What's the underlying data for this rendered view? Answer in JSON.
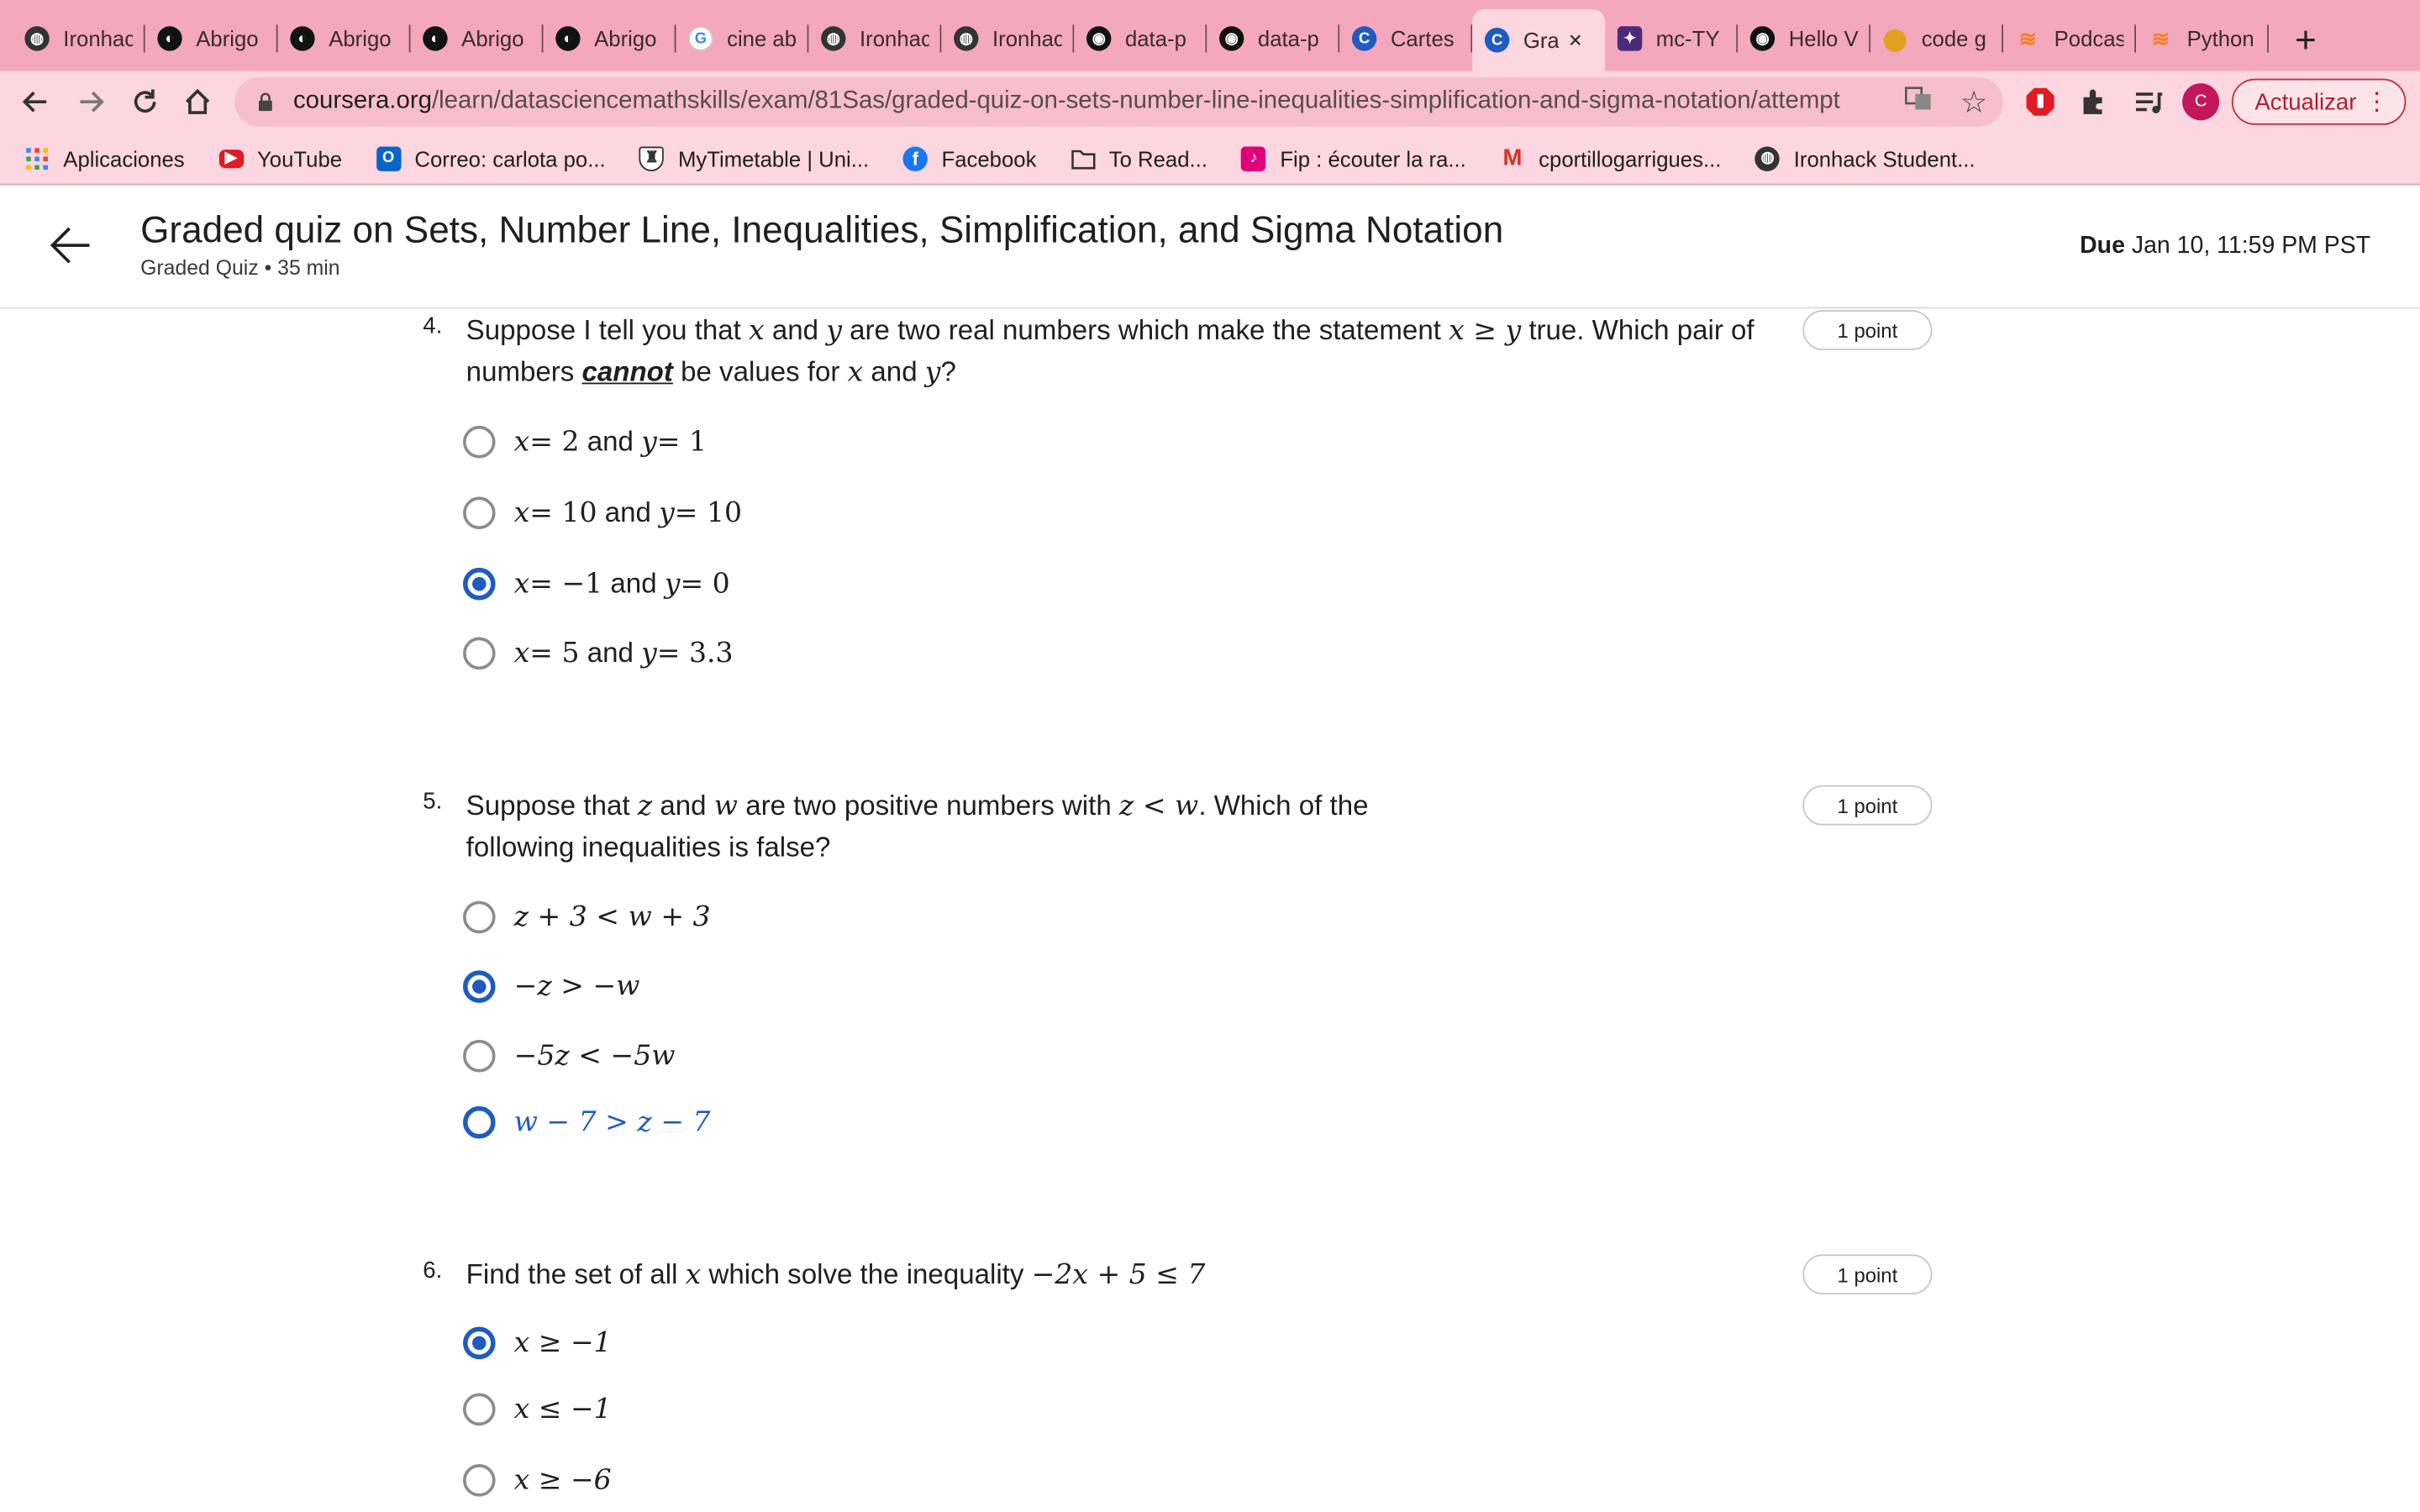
{
  "browser": {
    "tabs": [
      {
        "label": "Ironhac",
        "icon": "globe-icon",
        "color": "#333333"
      },
      {
        "label": "Abrigo",
        "icon": "brand-icon",
        "color": "#111111"
      },
      {
        "label": "Abrigo",
        "icon": "brand-icon",
        "color": "#111111"
      },
      {
        "label": "Abrigo",
        "icon": "brand-icon",
        "color": "#111111"
      },
      {
        "label": "Abrigo",
        "icon": "brand-icon",
        "color": "#111111"
      },
      {
        "label": "cine ab",
        "icon": "google-icon",
        "color": "#4285f4"
      },
      {
        "label": "Ironhac",
        "icon": "globe-icon",
        "color": "#333333"
      },
      {
        "label": "Ironhac",
        "icon": "globe-icon",
        "color": "#333333"
      },
      {
        "label": "data-p",
        "icon": "github-icon",
        "color": "#111111"
      },
      {
        "label": "data-p",
        "icon": "github-icon",
        "color": "#111111"
      },
      {
        "label": "Cartes",
        "icon": "coursera-icon",
        "color": "#1f5bc0"
      },
      {
        "label": "Gra",
        "icon": "coursera-icon",
        "color": "#1f5bc0",
        "active": true
      },
      {
        "label": "mc-TY",
        "icon": "shield-icon",
        "color": "#4b2a7a"
      },
      {
        "label": "Hello V",
        "icon": "github-icon",
        "color": "#111111"
      },
      {
        "label": "code g",
        "icon": "map-pin-icon",
        "color": "#e0a020"
      },
      {
        "label": "Podcas",
        "icon": "stack-icon",
        "color": "#f48024"
      },
      {
        "label": "Python",
        "icon": "stack-icon",
        "color": "#f48024"
      }
    ],
    "tab_close": "×",
    "new_tab": "+",
    "url_host": "coursera.org",
    "url_path": "/learn/datasciencemathskills/exam/81Sas/graded-quiz-on-sets-number-line-inequalities-simplification-and-sigma-notation/attempt",
    "update_label": "Actualizar",
    "profile_initial": "C",
    "bookmarks": [
      {
        "label": "Aplicaciones",
        "icon": "apps-grid-icon"
      },
      {
        "label": "YouTube",
        "icon": "youtube-icon"
      },
      {
        "label": "Correo: carlota po...",
        "icon": "outlook-icon"
      },
      {
        "label": "MyTimetable | Uni...",
        "icon": "crest-icon"
      },
      {
        "label": "Facebook",
        "icon": "facebook-icon"
      },
      {
        "label": "To Read...",
        "icon": "folder-icon"
      },
      {
        "label": "Fip : écouter la ra...",
        "icon": "fip-icon"
      },
      {
        "label": "cportillogarrigues...",
        "icon": "gmail-icon"
      },
      {
        "label": "Ironhack Student...",
        "icon": "globe-icon"
      }
    ]
  },
  "header": {
    "title": "Graded quiz on Sets, Number Line, Inequalities, Simplification, and Sigma Notation",
    "subtitle": "Graded Quiz • 35 min",
    "due_label": "Due",
    "due_value": "Jan 10, 11:59 PM PST"
  },
  "questions": [
    {
      "number": "4.",
      "points": "1 point",
      "text": {
        "p1": "Suppose I tell you that ",
        "m1": "x",
        "p2": " and ",
        "m2": "y",
        "p3": " are two real numbers which make the statement ",
        "m3": "x ≥ y",
        "p4": " true. Which pair of numbers ",
        "em": "cannot",
        "p5": " be values for ",
        "m4": "x",
        "p6": " and ",
        "m5": "y",
        "p7": "?"
      },
      "options": [
        {
          "a": "x",
          "b": " = 2",
          "c": " and ",
          "d": "y",
          "e": " = 1",
          "state": "unselected"
        },
        {
          "a": "x",
          "b": " = 10",
          "c": " and ",
          "d": "y",
          "e": " = 10",
          "state": "unselected"
        },
        {
          "a": "x",
          "b": " = −1",
          "c": " and ",
          "d": "y",
          "e": " = 0",
          "state": "selected"
        },
        {
          "a": "x",
          "b": " = 5",
          "c": " and ",
          "d": "y",
          "e": " = 3.3",
          "state": "unselected"
        }
      ]
    },
    {
      "number": "5.",
      "points": "1 point",
      "text": {
        "p1": "Suppose that ",
        "m1": "z",
        "p2": " and ",
        "m2": "w",
        "p3": " are two positive numbers with ",
        "m3": "z < w",
        "p4": ". Which of the following inequalities is false?"
      },
      "options": [
        {
          "expr": "z + 3 < w + 3",
          "state": "unselected"
        },
        {
          "expr": "−z > −w",
          "state": "selected"
        },
        {
          "expr": "−5z < −5w",
          "state": "unselected"
        },
        {
          "expr": "w − 7 > z − 7",
          "state": "focused"
        }
      ]
    },
    {
      "number": "6.",
      "points": "1 point",
      "text": {
        "p1": "Find the set of all ",
        "m1": "x",
        "p2": " which solve the inequality ",
        "m2": "−2x + 5 ≤ 7"
      },
      "options": [
        {
          "expr": "x ≥ −1",
          "state": "selected"
        },
        {
          "expr": "x ≤ −1",
          "state": "unselected"
        },
        {
          "expr": "x ≥ −6",
          "state": "unselected"
        }
      ]
    }
  ]
}
